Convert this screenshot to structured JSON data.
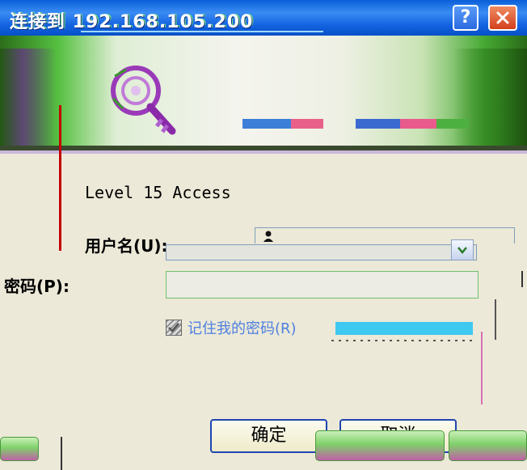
{
  "window": {
    "title": "连接到 192.168.105.200",
    "help_label": "?",
    "close_icon": "close-icon"
  },
  "banner": {
    "icon": "key-icon"
  },
  "form": {
    "access_level": "Level 15 Access",
    "username_label": "用户名(U):",
    "password_label": "密码(P):",
    "remember_label": "记住我的密码(R)",
    "remember_checked": true
  },
  "buttons": {
    "ok_label": "确定",
    "cancel_label": "取消"
  },
  "colors": {
    "titlebar": "#0A5FD8",
    "dialog_background": "#ECE9D8",
    "button_border": "#1F45B0",
    "close_button": "#D2401C"
  }
}
